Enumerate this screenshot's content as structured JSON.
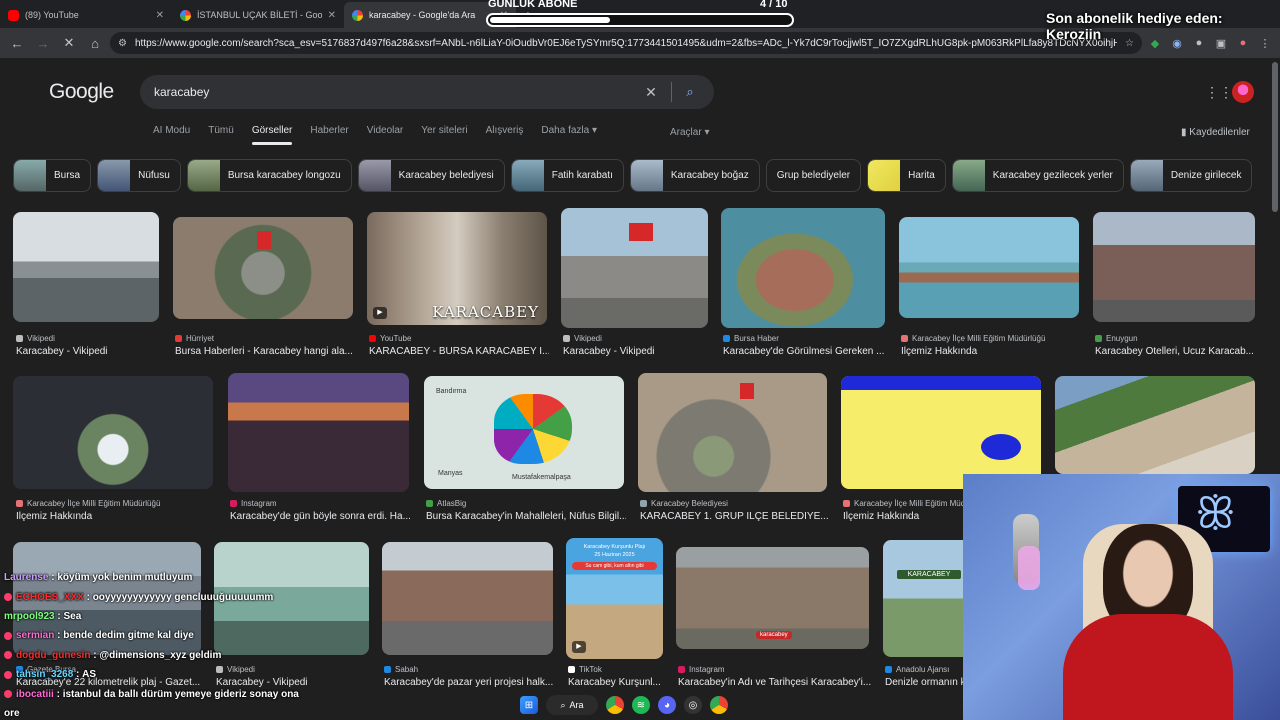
{
  "browser": {
    "tabs": [
      {
        "title": "(89) YouTube",
        "favicon_color": "#ff0000",
        "active": false
      },
      {
        "title": "İSTANBUL UÇAK BİLETİ - Googl",
        "favicon_color": "#4285f4",
        "active": false
      },
      {
        "title": "karacabey - Google'da Ara",
        "favicon_color": "#4285f4",
        "active": true
      }
    ],
    "new_tab": "+",
    "url": "https://www.google.com/search?sca_esv=5176837d497f6a28&sxsrf=ANbL-n6lLiaY-0iOudbVr0EJ6eTySYmr5Q:1773441501495&udm=2&fbs=ADc_l-Yk7dC9rTocjjwl5T_IO7ZXgdRLhUG8pk-pM063RkPlLfa8y8TDcNYX0oihjHX-_gadUwZ3..."
  },
  "google": {
    "logo": "Google",
    "query": "karacabey",
    "tabs": [
      "AI Modu",
      "Tümü",
      "Görseller",
      "Haberler",
      "Videolar",
      "Yer siteleri",
      "Alışveriş",
      "Daha fazla ▾"
    ],
    "selected_tab": "Görseller",
    "tools": "Araçlar ▾",
    "saved": "Kaydedilenler",
    "chips": [
      {
        "label": "Bursa",
        "thumb": "#5a6e74"
      },
      {
        "label": "Nüfusu",
        "thumb": "#6b7c8a"
      },
      {
        "label": "Bursa karacabey longozu",
        "thumb": "#7d8a70"
      },
      {
        "label": "Karacabey belediyesi",
        "thumb": "#7f8a9a"
      },
      {
        "label": "Fatih karabatı",
        "thumb": "#6a8a8e"
      },
      {
        "label": "Karacabey boğaz",
        "thumb": "#8a9aa8"
      },
      {
        "label": "Grup belediyeler",
        "thumb": ""
      },
      {
        "label": "Harita",
        "thumb": "#e6e25a"
      },
      {
        "label": "Karacabey gezilecek yerler",
        "thumb": "#6f8a6c"
      },
      {
        "label": "Denize girilecek",
        "thumb": "#8aa0b0"
      }
    ],
    "results": [
      {
        "source": "Vikipedi",
        "title": "Karacabey - Vikipedi",
        "dot": "#bdbdbd"
      },
      {
        "source": "Hürriyet",
        "title": "Bursa Haberleri - Karacabey hangi ala...",
        "dot": "#e53935"
      },
      {
        "source": "YouTube",
        "title": "KARACABEY - BURSA KARACABEY İ...",
        "dot": "#ff0000"
      },
      {
        "source": "Vikipedi",
        "title": "Karacabey - Vikipedi",
        "dot": "#bdbdbd"
      },
      {
        "source": "Bursa Haber",
        "title": "Karacabey'de Görülmesi Gereken ...",
        "dot": "#1e88e5"
      },
      {
        "source": "Karacabey İlçe Milli Eğitim Müdürlüğü",
        "title": "İlçemiz Hakkında",
        "dot": "#e57373"
      },
      {
        "source": "Enuygun",
        "title": "Karacabey Otelleri, Ucuz Karacab...",
        "dot": "#43a047"
      },
      {
        "source": "Karacabey İlçe Milli Eğitim Müdürlüğü",
        "title": "İlçemiz Hakkında",
        "dot": "#e57373"
      },
      {
        "source": "Instagram",
        "title": "Karacabey'de gün böyle sonra erdi. Ha...",
        "dot": "#d81b60"
      },
      {
        "source": "AtlasBig",
        "title": "Bursa Karacabey'in Mahalleleri, Nüfus Bilgil...",
        "dot": "#43a047"
      },
      {
        "source": "Karacabey Belediyesi",
        "title": "KARACABEY 1. GRUP İLÇE BELEDİYE...",
        "dot": "#90a4ae"
      },
      {
        "source": "Karacabey İlçe Milli Eğitim Müdürlüğü",
        "title": "İlçemiz Hakkında",
        "dot": "#e57373"
      },
      {
        "source": "Gazete Bursa",
        "title": "Karacabey'e 22 kilometrelik plaj - Gazet...",
        "dot": "#1e88e5"
      },
      {
        "source": "Vikipedi",
        "title": "Karacabey - Vikipedi",
        "dot": "#bdbdbd"
      },
      {
        "source": "Sabah",
        "title": "Karacabey'de pazar yeri projesi halk...",
        "dot": "#1e88e5"
      },
      {
        "source": "TikTok",
        "title": "Karacabey Kurşunl...",
        "dot": "#ffffff"
      },
      {
        "source": "Instagram",
        "title": "Karacabey'in Adı ve Tarihçesi Karacabey'i...",
        "dot": "#d81b60"
      },
      {
        "source": "Anadolu Ajansı",
        "title": "Denizle ormanın k...",
        "dot": "#1e88e5"
      }
    ],
    "watermark": "KARACABEY",
    "map_labels": [
      "Bandırma",
      "Manyas",
      "Mustafakemalpaşa"
    ],
    "beach_sign": [
      "Karacabey Kurşunlu Plajı",
      "25 Haziran 2025",
      "Su cam gibi, kum altın gibi"
    ],
    "city_sign": "KARACABEY",
    "drone_label": "karacabey"
  },
  "overlay": {
    "goal_title": "GÜNLÜK ABONE",
    "goal_count": "4 / 10",
    "goal_current": 4,
    "goal_target": 10,
    "sub_gift": "Son abonelik hediye eden: Keroziin"
  },
  "chat": [
    {
      "user": "Laurense",
      "msg": "köyüm yok benim mutluyum",
      "color": "#c9a0ff",
      "badge": false
    },
    {
      "user": "ECHOES_XXX",
      "msg": "ooyyyyyyyyyyyy gencluuuğuuuuumm",
      "color": "#ff2a2a",
      "badge": true
    },
    {
      "user": "mrpool923",
      "msg": "Sea",
      "color": "#7dff7d",
      "badge": false
    },
    {
      "user": "sermian",
      "msg": "bende dedim gitme kal diye",
      "color": "#ff6ad5",
      "badge": true
    },
    {
      "user": "dogdu_gunesin",
      "msg": "@dimensions_xyz geldim",
      "color": "#ff2a2a",
      "badge": true
    },
    {
      "user": "tahsin_3268",
      "msg": "AS",
      "color": "#6ad5ff",
      "badge": true
    },
    {
      "user": "ibocatiii",
      "msg": "istanbul da ballı dürüm yemeye gideriz sonay ona",
      "color": "#ff6ad5",
      "badge": true
    },
    {
      "user": "",
      "msg": "ore",
      "color": "#ffffff",
      "badge": false
    }
  ],
  "taskbar": {
    "search": "Ara"
  }
}
